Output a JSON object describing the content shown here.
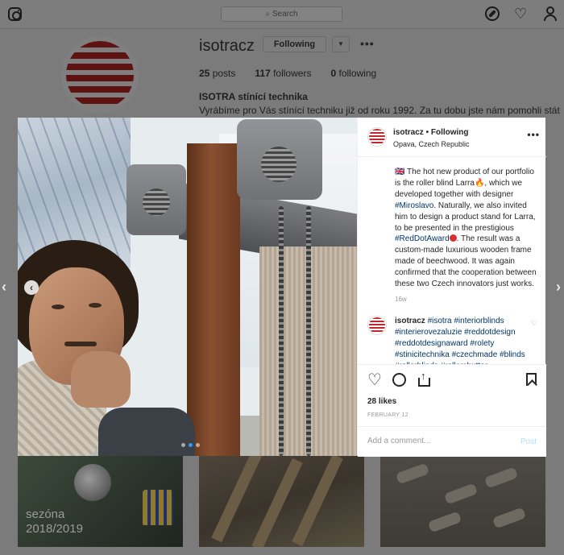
{
  "topbar": {
    "search_placeholder": "Search",
    "icons": [
      "instagram-icon",
      "compass-icon",
      "heart-icon",
      "person-icon"
    ]
  },
  "profile": {
    "username": "isotracz",
    "follow_label": "Following",
    "dropdown_symbol": "▼",
    "more_symbol": "•••",
    "posts_count": "25",
    "posts_label": "posts",
    "followers_count": "117",
    "followers_label": "followers",
    "following_count": "0",
    "following_label": "following",
    "full_name": "ISOTRA stínící technika",
    "bio": "Vyrábíme pro Vás stínící techniku již od roku 1992. Za tu dobu jste nám pomohli stát"
  },
  "grid": {
    "tile1_text_line1": "sezóna",
    "tile1_text_line2": "2018/2019"
  },
  "nav": {
    "prev_symbol": "‹",
    "next_symbol": "›"
  },
  "post": {
    "username": "isotracz",
    "separator": " • ",
    "follow_status": "Following",
    "location": "Opava, Czech Republic",
    "more_symbol": "•••",
    "caption_flag": "🇬🇧",
    "caption_part1": " The hot new product of our portfolio is the roller blind Larra",
    "caption_fire": "🔥",
    "caption_part2": ", which we developed together with designer ",
    "caption_tag1": "#Miroslavo",
    "caption_part3": ". Naturally, we also invited him to design a product stand for Larra, to be presented in the prestigious ",
    "caption_tag2": "#RedDotAward",
    "caption_part4": ". The result was a custom-made luxurious wooden frame made of beechwood. It was again confirmed that the cooperation between these two Czech innovators just works.",
    "time_ago": "16w",
    "comment_user": "isotracz",
    "comment_tags": "#isotra #interiorblinds #interierovezaluzie #reddotdesign #reddotdesignaward #rolety #stinicitechnika #czechmade #blinds #rollerblinds #rollershutter",
    "likes": "28 likes",
    "date": "FEBRUARY 12",
    "comment_placeholder": "Add a comment...",
    "post_label": "Post",
    "photo_prev_symbol": "‹",
    "carousel_count": 3,
    "carousel_active": 1
  },
  "colors": {
    "brand_red": "#c2272d",
    "link_blue": "#003569",
    "accent_blue": "#3897f0",
    "post_btn_disabled": "#b2dffc"
  }
}
